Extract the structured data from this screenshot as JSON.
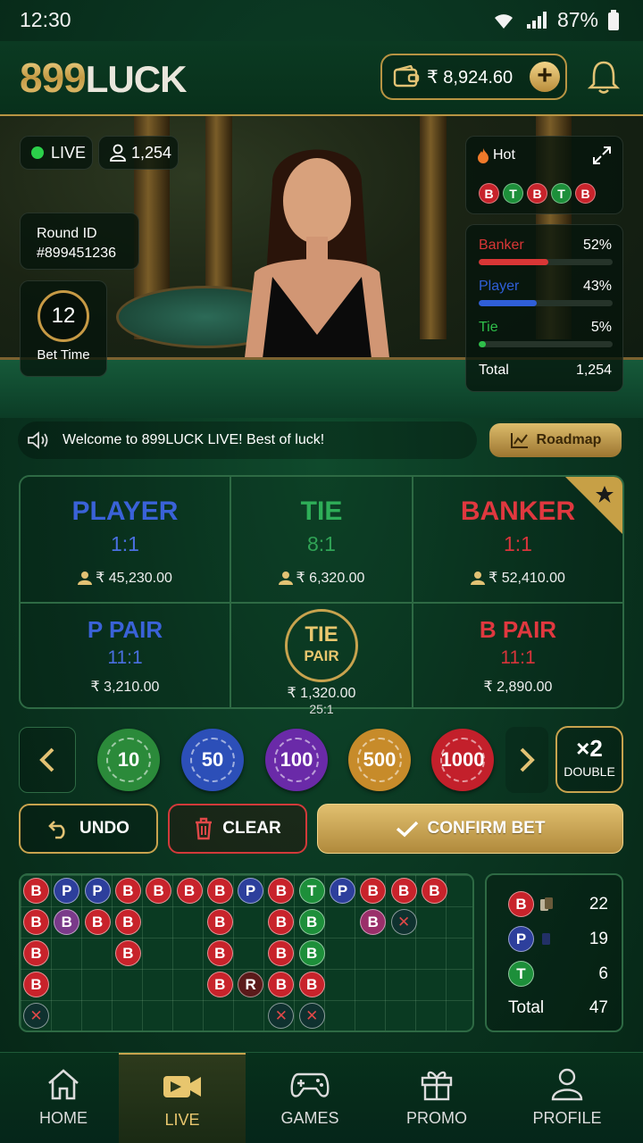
{
  "status": {
    "time": "12:30",
    "battery": "87%"
  },
  "header": {
    "logo_num": "899",
    "logo_word": "LUCK",
    "balance": "₹ 8,924.60"
  },
  "video": {
    "live": "LIVE",
    "viewers": "1,254",
    "round_label": "Round ID",
    "round_id": "#899451236",
    "bet_time_value": "12",
    "bet_time_label": "Bet Time"
  },
  "hot": {
    "label": "Hot",
    "trend": [
      "B",
      "T",
      "B",
      "T",
      "B"
    ]
  },
  "stats": {
    "rows": [
      {
        "name": "Banker",
        "pct": "52%",
        "value": 52,
        "color": "#d93636"
      },
      {
        "name": "Player",
        "pct": "43%",
        "value": 43,
        "color": "#2f5fd8"
      },
      {
        "name": "Tie",
        "pct": "5%",
        "value": 5,
        "color": "#2fbf4a"
      }
    ],
    "total_label": "Total",
    "total": "1,254"
  },
  "ticker": {
    "text": "Welcome to 899LUCK LIVE! Best of luck!",
    "roadmap": "Roadmap"
  },
  "bets": {
    "player": {
      "name": "PLAYER",
      "odds": "1:1",
      "amount": "₹ 45,230.00"
    },
    "tie": {
      "name": "TIE",
      "odds": "8:1",
      "amount": "₹ 6,320.00"
    },
    "banker": {
      "name": "BANKER",
      "odds": "1:1",
      "amount": "₹ 52,410.00"
    },
    "ppair": {
      "name": "P PAIR",
      "odds": "11:1",
      "amount": "₹ 3,210.00"
    },
    "tiepair": {
      "name": "TIE",
      "sub": "PAIR",
      "odds": "25:1",
      "amount": "₹ 1,320.00"
    },
    "bpair": {
      "name": "B PAIR",
      "odds": "11:1",
      "amount": "₹ 2,890.00"
    }
  },
  "chips": [
    "10",
    "50",
    "100",
    "500",
    "1000"
  ],
  "double": {
    "x": "×2",
    "label": "DOUBLE"
  },
  "actions": {
    "undo": "UNDO",
    "clear": "CLEAR",
    "confirm": "CONFIRM BET"
  },
  "summary": {
    "banker": {
      "l": "B",
      "v": "22"
    },
    "player": {
      "l": "P",
      "v": "19"
    },
    "tie": {
      "l": "T",
      "v": "6"
    },
    "total_label": "Total",
    "total": "47"
  },
  "nav": [
    "HOME",
    "LIVE",
    "GAMES",
    "PROMO",
    "PROFILE"
  ],
  "colors": {
    "banker": "#c8232b",
    "player": "#2d3f9c",
    "tie": "#1d8f3a",
    "gold": "#c8a34e"
  }
}
